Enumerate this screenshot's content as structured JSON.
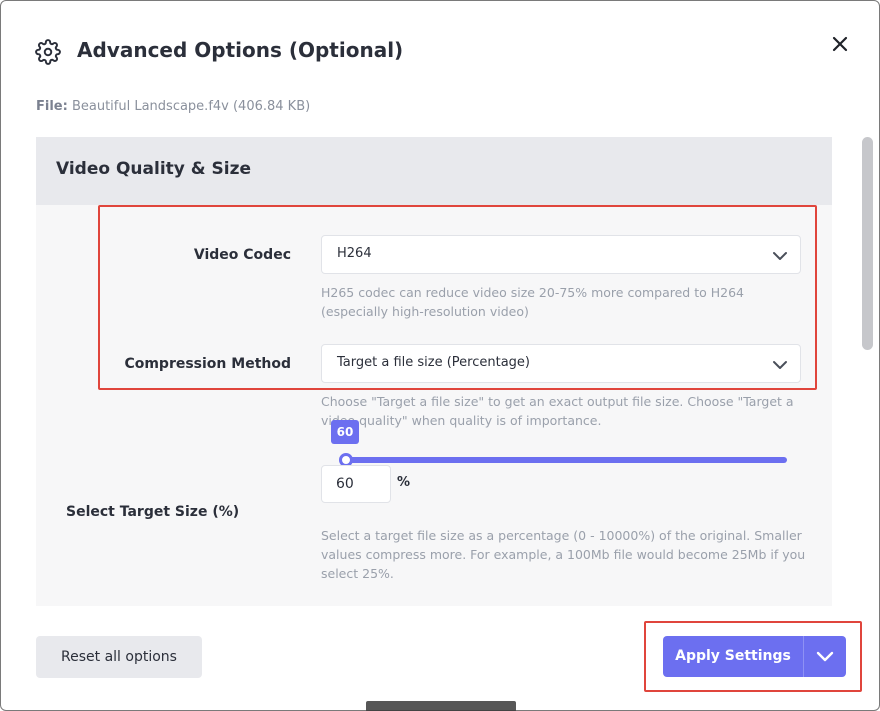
{
  "dialog": {
    "title": "Advanced Options (Optional)",
    "file_label": "File:",
    "file_value": "Beautiful Landscape.f4v (406.84 KB)"
  },
  "panel": {
    "title": "Video Quality & Size",
    "video_codec": {
      "label": "Video Codec",
      "value": "H264",
      "help_line1": "H265 codec can reduce video size 20-75% more compared to H264",
      "help_line2": "(especially high-resolution video)"
    },
    "compression": {
      "label": "Compression Method",
      "value": "Target a file size (Percentage)",
      "help_line1": "Choose \"Target a file size\" to get an exact output file size. Choose \"Target a",
      "help_line2": "video quality\" when quality is of importance."
    },
    "target_size": {
      "label": "Select Target Size (%)",
      "slider_value": "60",
      "input_value": "60",
      "unit": "%",
      "help_line1": "Select a target file size as a percentage (0 - 10000%) of the original. Smaller",
      "help_line2": "values compress more. For example, a 100Mb file would become 25Mb if you",
      "help_line3": "select 25%."
    }
  },
  "footer": {
    "reset_label": "Reset all options",
    "apply_label": "Apply Settings"
  },
  "colors": {
    "accent": "#6c6ff0",
    "highlight": "#e0453c",
    "panel_bg": "#f7f7f8",
    "panel_head_bg": "#e8e9ed"
  },
  "icons": [
    "gear-icon",
    "close-icon",
    "chevron-down-icon"
  ]
}
